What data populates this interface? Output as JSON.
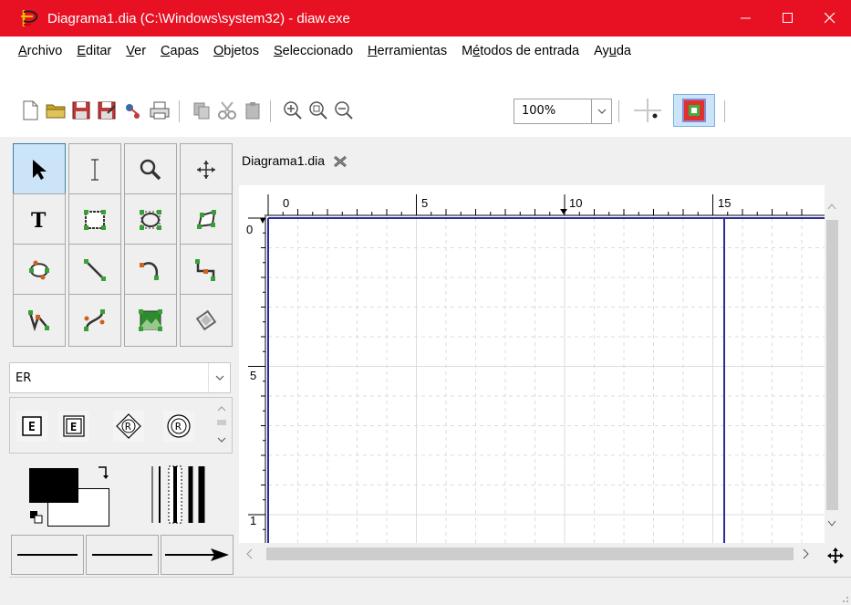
{
  "window": {
    "title": "Diagrama1.dia (C:\\Windows\\system32) - diaw.exe",
    "title_bg": "#e81123"
  },
  "menu": {
    "items": [
      {
        "pre": "",
        "key": "A",
        "post": "rchivo"
      },
      {
        "pre": "",
        "key": "E",
        "post": "ditar"
      },
      {
        "pre": "",
        "key": "V",
        "post": "er"
      },
      {
        "pre": "",
        "key": "C",
        "post": "apas"
      },
      {
        "pre": "",
        "key": "O",
        "post": "bjetos"
      },
      {
        "pre": "",
        "key": "S",
        "post": "eleccionado"
      },
      {
        "pre": "",
        "key": "H",
        "post": "erramientas"
      },
      {
        "pre": "M",
        "key": "é",
        "post": "todos de entrada"
      },
      {
        "pre": "Ay",
        "key": "u",
        "post": "da"
      }
    ]
  },
  "toolbar": {
    "zoom_value": "100%",
    "icons": [
      "new-file-icon",
      "open-folder-icon",
      "save-icon",
      "save-as-icon",
      "export-icon",
      "print-icon",
      "copy-icon",
      "cut-icon",
      "paste-icon",
      "zoom-in-icon",
      "zoom-best-fit-icon",
      "zoom-out-icon",
      "snap-to-grid-icon",
      "snap-to-object-icon"
    ]
  },
  "toolbox": {
    "tools": [
      "pointer-tool",
      "text-edit-tool",
      "magnify-tool",
      "scroll-tool",
      "text-tool",
      "box-tool",
      "ellipse-tool",
      "polygon-tool",
      "beziergon-tool",
      "line-tool",
      "arc-tool",
      "zigzag-line-tool",
      "polyline-tool",
      "bezier-line-tool",
      "image-tool",
      "outline-tool"
    ],
    "sheet_name": "ER",
    "sheet_shapes": [
      "E",
      "E",
      "R",
      "R"
    ]
  },
  "canvas": {
    "tab_label": "Diagrama1.dia",
    "hruler_labels": [
      "0",
      "5",
      "10",
      "15"
    ],
    "vruler_labels": [
      "0",
      "5",
      "1"
    ],
    "grid_color": "#d8dde0",
    "page_border_color": "#2b2b9b"
  }
}
